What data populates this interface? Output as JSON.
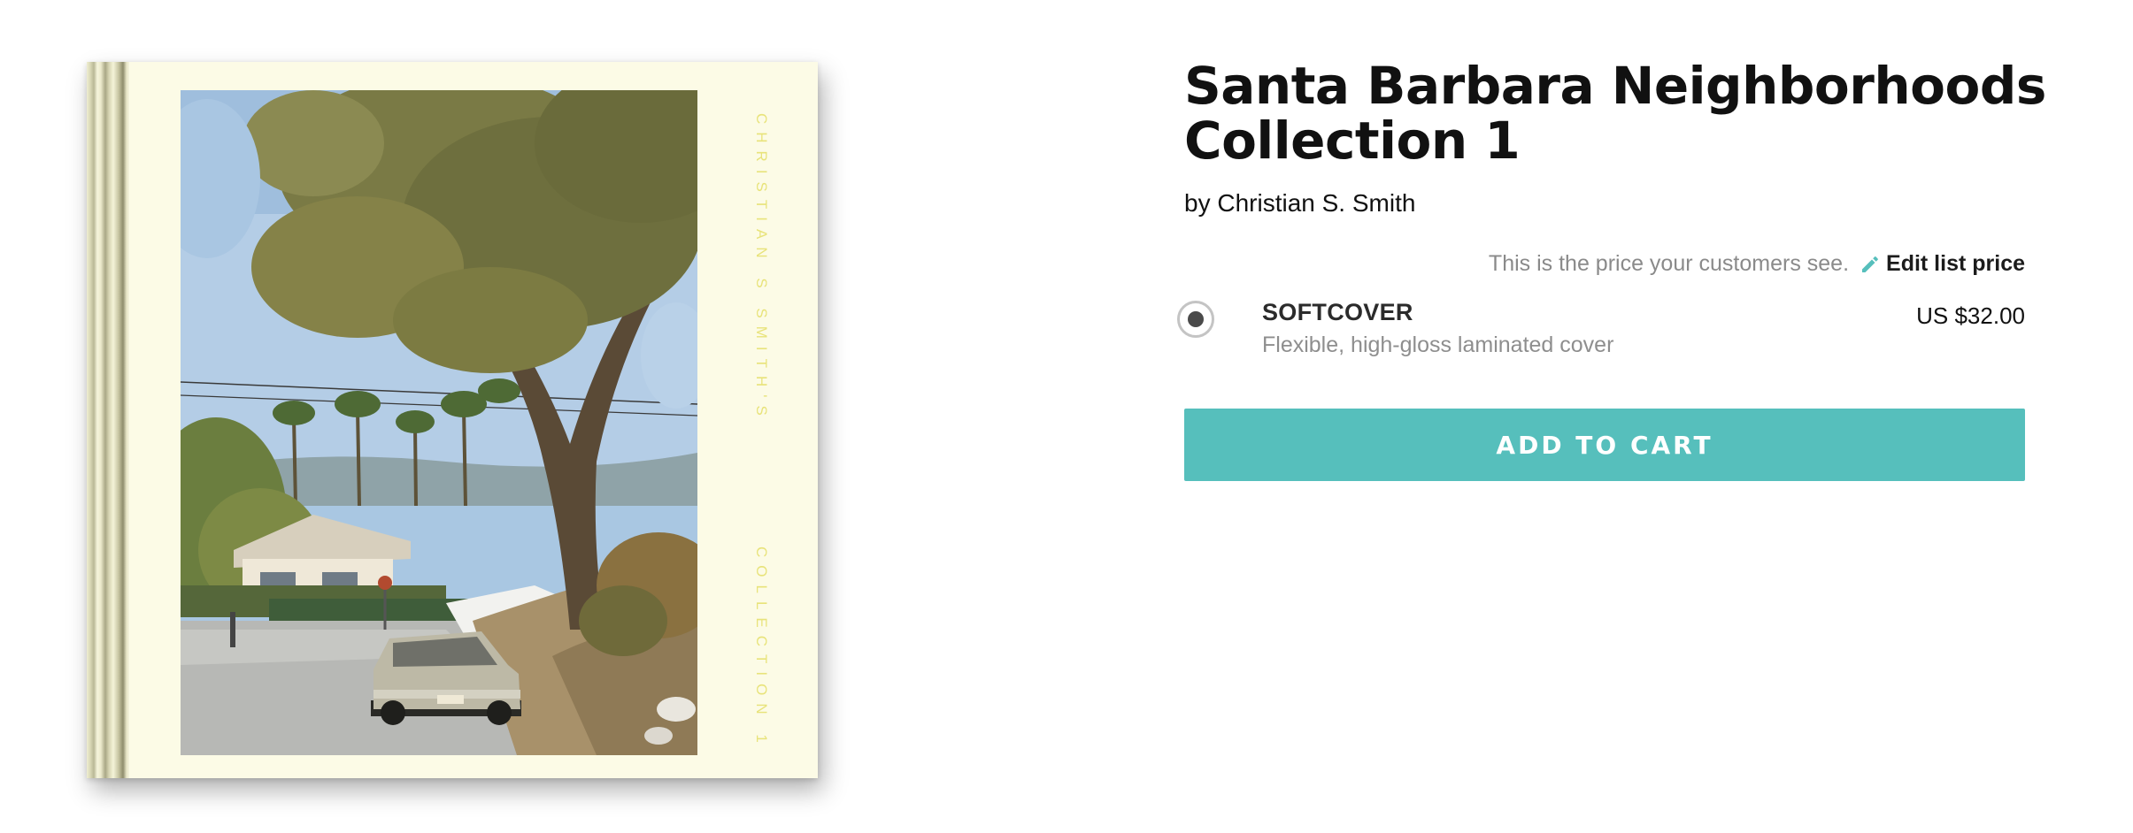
{
  "book": {
    "cover_author_text": "CHRISTIAN S SMITH'S",
    "cover_collection_text": "COLLECTION 1",
    "cover_image": "suburban-street-tree-parked-car-photo"
  },
  "product": {
    "title": "Santa Barbara Neighborhoods Collection 1",
    "byline": "by Christian S. Smith",
    "price_note": "This is the price your customers see.",
    "edit_label": "Edit list price",
    "edit_icon": "pencil-icon",
    "options": [
      {
        "name": "SOFTCOVER",
        "description": "Flexible, high-gloss laminated cover",
        "price": "US $32.00",
        "selected": true
      }
    ],
    "add_to_cart_label": "ADD TO CART"
  },
  "colors": {
    "accent": "#56bfbc",
    "cover_background": "#fcfbe6",
    "cover_text": "#e8e37a",
    "muted_text": "#8a8a8a"
  }
}
